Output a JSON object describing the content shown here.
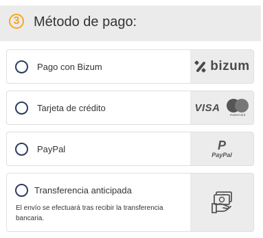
{
  "section": {
    "step_number": "3",
    "title": "Método de pago:",
    "accent_color": "#f5a623"
  },
  "options": [
    {
      "label": "Pago con Bizum",
      "logo_text": "bizum",
      "icon": "bizum-logo-icon",
      "selected": false
    },
    {
      "label": "Tarjeta de crédito",
      "logo_text": "VISA",
      "logo_text_secondary": "mastercard",
      "icon": "visa-mastercard-icon",
      "selected": false
    },
    {
      "label": "PayPal",
      "logo_text": "PayPal",
      "icon": "paypal-logo-icon",
      "selected": false
    },
    {
      "label": "Transferencia anticipada",
      "description": "El envío se efectuará tras recibir la transferencia bancaria.",
      "icon": "bank-transfer-icon",
      "selected": false
    }
  ],
  "colors": {
    "radio_border": "#2a3b5e",
    "logo_panel_bg": "#ececec",
    "header_bg": "#ebebeb"
  }
}
